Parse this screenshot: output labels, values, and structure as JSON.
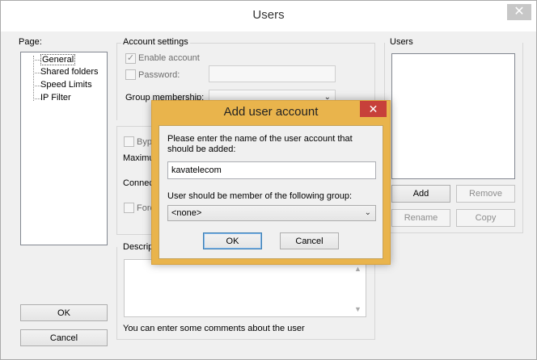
{
  "window": {
    "title": "Users",
    "close_glyph": "✕"
  },
  "page_panel": {
    "label": "Page:",
    "items": [
      {
        "label": "General"
      },
      {
        "label": "Shared folders"
      },
      {
        "label": "Speed Limits"
      },
      {
        "label": "IP Filter"
      }
    ],
    "ok_label": "OK",
    "cancel_label": "Cancel"
  },
  "account_settings": {
    "label": "Account settings",
    "enable_account": "Enable account",
    "enable_checked": true,
    "password": "Password:",
    "password_value": "",
    "group_membership": "Group membership:",
    "check_glyph": "✓"
  },
  "middle": {
    "bypass": "Bypa",
    "maximum": "Maximu",
    "connect": "Connec",
    "force": "Forc"
  },
  "description": {
    "label": "Descrip",
    "hint": "You can enter some comments about the user"
  },
  "users_panel": {
    "label": "Users",
    "add": "Add",
    "remove": "Remove",
    "rename": "Rename",
    "copy": "Copy"
  },
  "dialog": {
    "title": "Add user account",
    "close_glyph": "✕",
    "prompt": "Please enter the name of the user account that should be added:",
    "username_value": "kavatelecom",
    "group_prompt": "User should be member of the following group:",
    "group_selected": "<none>",
    "ok": "OK",
    "cancel": "Cancel"
  },
  "colors": {
    "dialog_frame": "#e9b44c",
    "close_red": "#c7403a"
  }
}
